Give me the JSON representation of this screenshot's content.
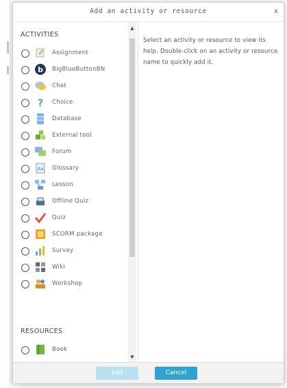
{
  "dialog": {
    "title": "Add an activity or resource",
    "close_label": "x"
  },
  "activities": {
    "header": "ACTIVITIES",
    "items": [
      {
        "label": "Assignment",
        "icon": "assignment-icon"
      },
      {
        "label": "BigBlueButtonBN",
        "icon": "bigbluebutton-icon"
      },
      {
        "label": "Chat",
        "icon": "chat-icon"
      },
      {
        "label": "Choice",
        "icon": "choice-icon"
      },
      {
        "label": "Database",
        "icon": "database-icon"
      },
      {
        "label": "External tool",
        "icon": "external-tool-icon"
      },
      {
        "label": "Forum",
        "icon": "forum-icon"
      },
      {
        "label": "Glossary",
        "icon": "glossary-icon"
      },
      {
        "label": "Lesson",
        "icon": "lesson-icon"
      },
      {
        "label": "Offline Quiz",
        "icon": "offline-quiz-icon"
      },
      {
        "label": "Quiz",
        "icon": "quiz-icon"
      },
      {
        "label": "SCORM package",
        "icon": "scorm-icon"
      },
      {
        "label": "Survey",
        "icon": "survey-icon"
      },
      {
        "label": "Wiki",
        "icon": "wiki-icon"
      },
      {
        "label": "Workshop",
        "icon": "workshop-icon"
      }
    ]
  },
  "resources": {
    "header": "RESOURCES",
    "items": [
      {
        "label": "Book",
        "icon": "book-icon"
      }
    ]
  },
  "help": {
    "text": "Select an activity or resource to view its help. Double-click on an activity or resource name to quickly add it."
  },
  "footer": {
    "add_label": "Add",
    "cancel_label": "Cancel"
  },
  "colors": {
    "cancel_button": "#30a3cc",
    "add_button_disabled": "#b9e0ee"
  }
}
